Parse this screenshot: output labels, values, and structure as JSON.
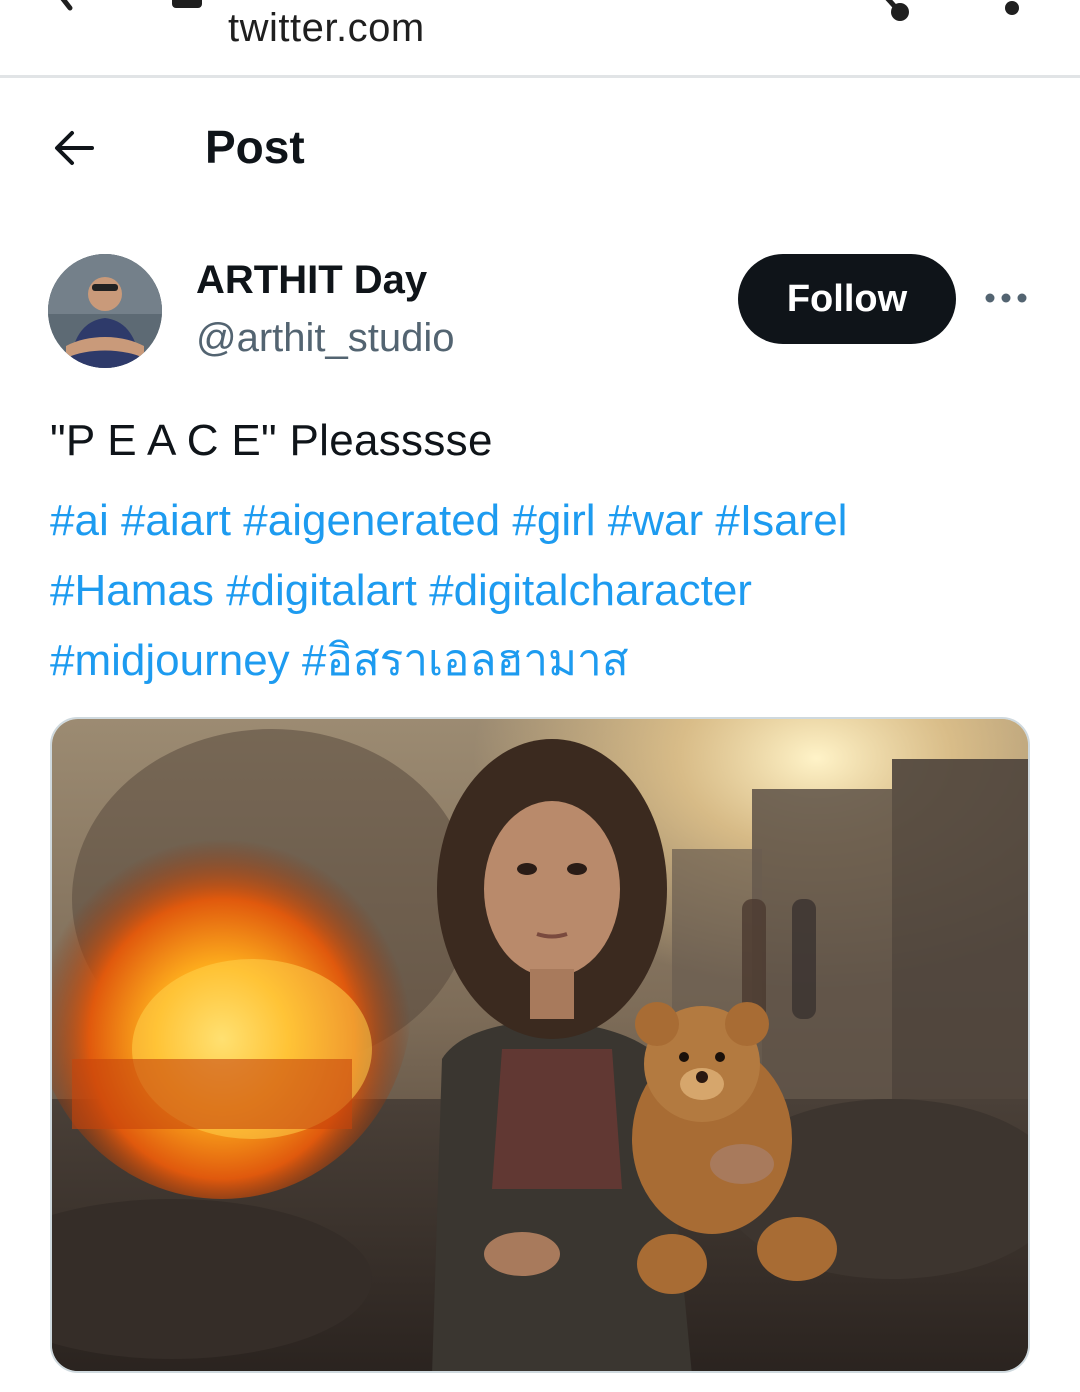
{
  "browser": {
    "url": "twitter.com",
    "icons": [
      "back-icon",
      "lock-icon",
      "share-icon",
      "more-vertical-icon"
    ]
  },
  "header": {
    "title": "Post",
    "back_icon": "arrow-left-icon"
  },
  "author": {
    "display_name": "ARTHIT Day",
    "handle": "@arthit_studio",
    "follow_label": "Follow",
    "more_icon": "more-horizontal-icon"
  },
  "post": {
    "text": "\"P E A C E\" Pleasssse",
    "hashtags": [
      "#ai",
      "#aiart",
      "#aigenerated",
      "#girl",
      "#war",
      "#Isarel",
      "#Hamas",
      "#digitalart",
      "#digitalcharacter",
      "#midjourney",
      "#อิสราเอลฮามาส"
    ]
  },
  "colors": {
    "link": "#1d9bf0",
    "text_primary": "#0f1419",
    "text_secondary": "#536471",
    "button_dark": "#0f1419"
  }
}
